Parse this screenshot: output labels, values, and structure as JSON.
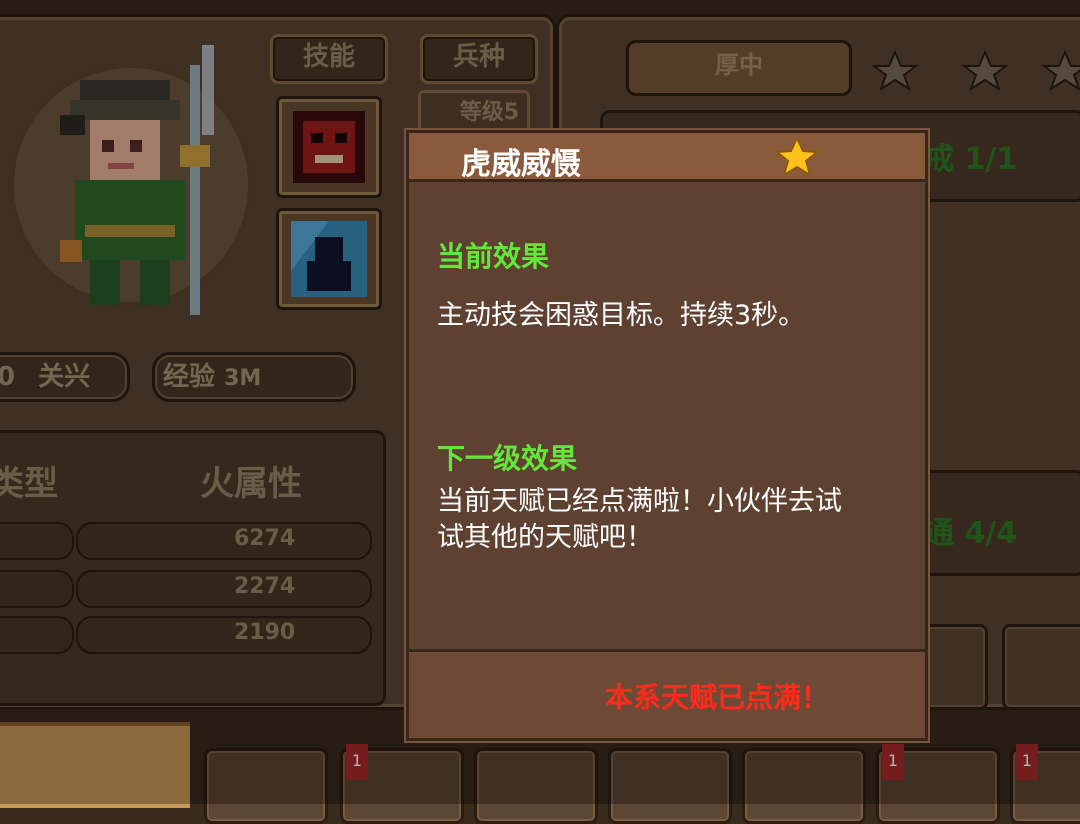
{
  "hero": {
    "name_partial": "0",
    "name": "关兴",
    "exp_label": "经验",
    "exp_value": "3M",
    "level_label": "等级5"
  },
  "tabs": {
    "skills": "技能",
    "troops": "兵种"
  },
  "stats": {
    "type_label": "类型",
    "type_value": "火属性",
    "values": [
      "6274",
      "2274",
      "2190"
    ]
  },
  "right_panel": {
    "header_fragment": "厚中",
    "row1_fragment": "戒 1/1",
    "row2_fragment": "通 4/4"
  },
  "tooltip": {
    "title": "虎威威慑",
    "current_label": "当前效果",
    "current_text": "主动技会困惑目标。持续3秒。",
    "next_label": "下一级效果",
    "next_text_line1": "当前天赋已经点满啦！小伙伴去试",
    "next_text_line2": "试其他的天赋吧！",
    "footer": "本系天赋已点满！"
  },
  "bottom_bar": {
    "badges": [
      "1",
      "1",
      "1"
    ]
  },
  "colors": {
    "green_label": "#62e83a",
    "red_notice": "#ff2a1a",
    "star": "#ffc21a"
  }
}
